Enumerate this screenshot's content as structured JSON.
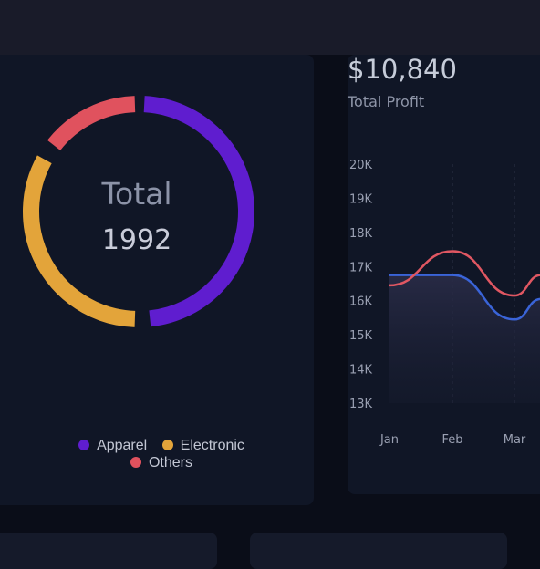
{
  "colors": {
    "apparel": "#5f1dcf",
    "electronic": "#e3a43a",
    "others": "#e0525e",
    "series_blue": "#3a64d8",
    "series_red": "#e05762"
  },
  "donut": {
    "title": "Total",
    "total": "1992",
    "segments": [
      {
        "label": "Apparel",
        "color_key": "apparel"
      },
      {
        "label": "Electronic",
        "color_key": "electronic"
      },
      {
        "label": "Others",
        "color_key": "others"
      }
    ]
  },
  "profit": {
    "value": "$10,840",
    "label": "Total Profit"
  },
  "chart_data": {
    "type": "line",
    "x": [
      "Jan",
      "Feb",
      "Mar"
    ],
    "y_ticks": [
      "20K",
      "19K",
      "18K",
      "17K",
      "16K",
      "15K",
      "14K",
      "13K"
    ],
    "ylim": [
      13000,
      20000
    ],
    "series": [
      {
        "color_key": "series_blue",
        "values": [
          16750,
          16750,
          15450
        ]
      },
      {
        "color_key": "series_red",
        "values": [
          16450,
          17450,
          16150
        ]
      }
    ],
    "grid": "vertical-dashed"
  }
}
